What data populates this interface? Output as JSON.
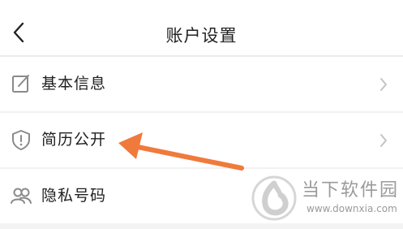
{
  "header": {
    "title": "账户设置",
    "back_icon": "chevron-left-icon"
  },
  "settings": [
    {
      "label": "基本信息",
      "icon": "edit-icon"
    },
    {
      "label": "简历公开",
      "icon": "shield-alert-icon"
    },
    {
      "label": "隐私号码",
      "icon": "users-icon"
    }
  ],
  "annotation": {
    "type": "arrow",
    "color": "#f07a3c",
    "points_to": "简历公开"
  },
  "watermark": {
    "title": "当下软件园",
    "url": "www.downxia.com"
  }
}
